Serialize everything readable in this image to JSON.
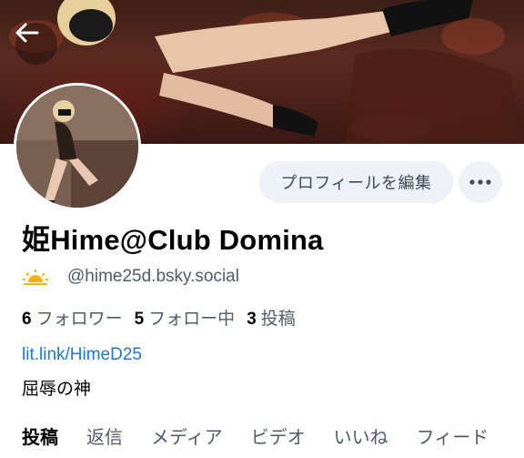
{
  "header": {
    "back_icon": "arrow-left-icon",
    "banner_image": "banner-photo"
  },
  "profile": {
    "avatar_image": "avatar-photo",
    "display_name": "姫Hime@Club Domina",
    "status_icon": "sunrise-icon",
    "handle": "@hime25d.bsky.social",
    "link": "lit.link/HimeD25",
    "bio": "屈辱の神"
  },
  "actions": {
    "edit_profile_label": "プロフィールを編集",
    "more_icon": "more-horizontal-icon"
  },
  "stats": {
    "followers_count": "6",
    "followers_label": "フォロワー",
    "following_count": "5",
    "following_label": "フォロー中",
    "posts_count": "3",
    "posts_label": "投稿"
  },
  "tabs": [
    {
      "label": "投稿",
      "active": true
    },
    {
      "label": "返信"
    },
    {
      "label": "メディア"
    },
    {
      "label": "ビデオ"
    },
    {
      "label": "いいね"
    },
    {
      "label": "フィード"
    }
  ],
  "colors": {
    "accent_link": "#1a78d6",
    "muted_text": "#4f5c6b",
    "button_bg": "#eef1f5"
  }
}
